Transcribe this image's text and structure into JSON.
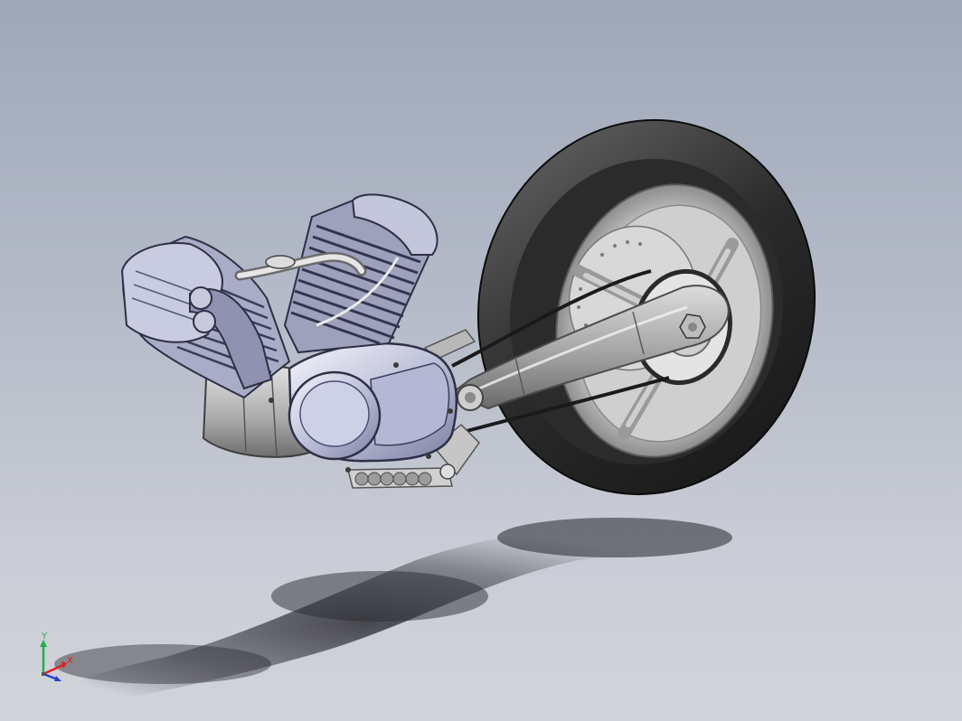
{
  "viewport": {
    "background_top": "#9fa8ba",
    "background_bottom": "#d2d3da"
  },
  "model": {
    "icon": "motorcycle-engine-swingarm-wheel-assembly"
  },
  "triad": {
    "y_label": "Y",
    "x_label": "X",
    "y_color": "#22b14c",
    "x_color": "#e02020",
    "z_color": "#2a3fd0"
  }
}
